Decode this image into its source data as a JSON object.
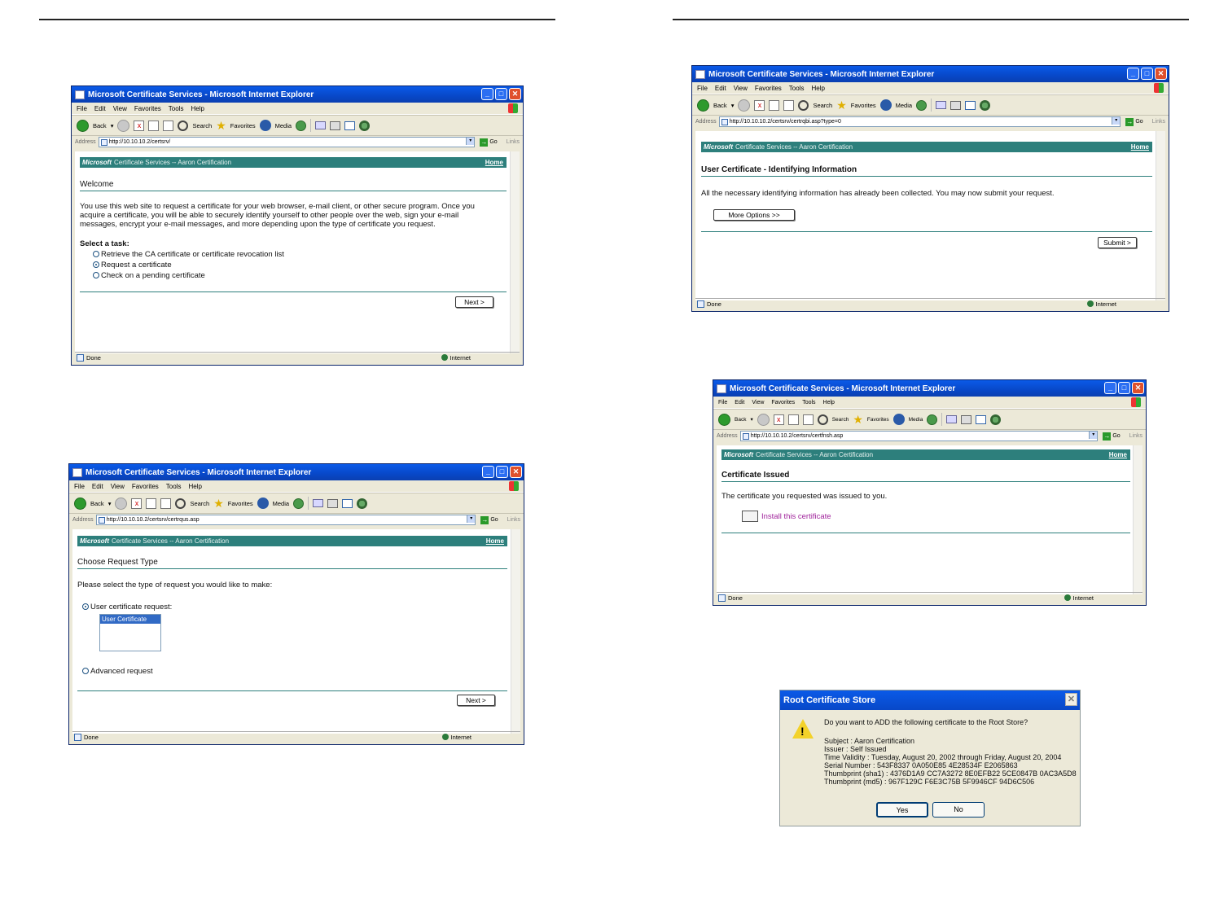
{
  "browser": {
    "window_title": "Microsoft Certificate Services - Microsoft Internet Explorer",
    "menu": [
      "File",
      "Edit",
      "View",
      "Favorites",
      "Tools",
      "Help"
    ],
    "toolbar": {
      "back": "Back",
      "search": "Search",
      "favorites": "Favorites",
      "media": "Media"
    },
    "address_label": "Address",
    "go_label": "Go",
    "links_label": "Links",
    "status_done": "Done",
    "status_zone": "Internet"
  },
  "banner": {
    "brand": "Microsoft",
    "service": "Certificate Services  --  Aaron Certification",
    "home": "Home"
  },
  "welcome": {
    "url": "http://10.10.10.2/certsrv/",
    "heading": "Welcome",
    "p1": "You use this web site to request a certificate for your web browser, e-mail client, or other secure program. Once you",
    "p2": "acquire a certificate, you will be able to securely identify yourself to other people over the web, sign your e-mail",
    "p3": "messages, encrypt your e-mail messages, and more depending upon the type of certificate you request.",
    "task_label": "Select a task:",
    "tasks": [
      "Retrieve the CA certificate or certificate revocation list",
      "Request a certificate",
      "Check on a pending certificate"
    ],
    "next": "Next >"
  },
  "request_type": {
    "url": "http://10.10.10.2/certsrv/certrqus.asp",
    "heading": "Choose Request Type",
    "prompt": "Please select the type of request you would like to make:",
    "option1": "User certificate request:",
    "list_item": "User Certificate",
    "option2": "Advanced request",
    "next": "Next >"
  },
  "identifying": {
    "url": "http://10.10.10.2/certsrv/certrqbi.asp?type=0",
    "heading": "User Certificate - Identifying Information",
    "text": "All the necessary identifying information has already been collected. You may now submit your request.",
    "more": "More Options >>",
    "submit": "Submit >"
  },
  "issued": {
    "url": "http://10.10.10.2/certsrv/certfnsh.asp",
    "heading": "Certificate Issued",
    "text": "The certificate you requested was issued to you.",
    "link": "Install this certificate"
  },
  "dialog": {
    "title": "Root Certificate Store",
    "question": "Do you want to ADD the following certificate to the Root Store?",
    "subject": "Subject : Aaron Certification",
    "issuer": "Issuer : Self Issued",
    "validity": "Time Validity : Tuesday, August 20, 2002 through Friday, August 20, 2004",
    "serial": "Serial Number : 543F8337 0A050E85 4E28534F E2065863",
    "sha1": "Thumbprint (sha1) : 4376D1A9 CC7A3272 8E0EFB22 5CE0847B 0AC3A5D8",
    "md5": "Thumbprint (md5) : 967F129C F6E3C75B 5F9946CF 94D6C506",
    "yes": "Yes",
    "no": "No"
  }
}
